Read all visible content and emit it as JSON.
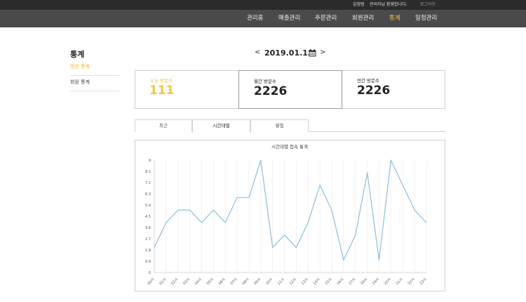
{
  "topbar": {
    "user": "김정범",
    "welcome": "관리자님 환영합니다.",
    "logout": "로그아웃"
  },
  "nav": {
    "items": [
      {
        "label": "관리홈",
        "active": false
      },
      {
        "label": "매출관리",
        "active": false
      },
      {
        "label": "주문관리",
        "active": false
      },
      {
        "label": "회원관리",
        "active": false
      },
      {
        "label": "통계",
        "active": true
      },
      {
        "label": "일정관리",
        "active": false
      }
    ],
    "active_color": "#f6c343"
  },
  "sidebar": {
    "title": "통계",
    "items": [
      {
        "label": "방문 통계",
        "active": true
      },
      {
        "label": "회원 통계",
        "active": false
      }
    ]
  },
  "date_nav": {
    "prev": "<",
    "date": "2019.01.13",
    "next": ">",
    "calendar_icon": "calendar-icon"
  },
  "stats": [
    {
      "label": "오늘 방문수",
      "value": "111",
      "color": "#f6c343"
    },
    {
      "label": "월간 방문수",
      "value": "2226",
      "color": "#222222"
    },
    {
      "label": "연간 방문수",
      "value": "2226",
      "color": "#222222"
    }
  ],
  "tabs": [
    {
      "label": "최근",
      "active": false
    },
    {
      "label": "시간대별",
      "active": true
    },
    {
      "label": "월별",
      "active": false
    }
  ],
  "chart_data": {
    "type": "line",
    "title": "시간대별 접속 통계",
    "categories": [
      "00시",
      "01시",
      "02시",
      "03시",
      "04시",
      "05시",
      "06시",
      "07시",
      "08시",
      "09시",
      "10시",
      "11시",
      "12시",
      "13시",
      "14시",
      "15시",
      "16시",
      "17시",
      "18시",
      "19시",
      "20시",
      "21시",
      "22시",
      "23시"
    ],
    "values": [
      2,
      4,
      5,
      5,
      4,
      5,
      4,
      6,
      6,
      9,
      2,
      3,
      2,
      4,
      7,
      5,
      1,
      3,
      8,
      1,
      9,
      7,
      5,
      4
    ],
    "yticks": [
      "0",
      "0.9",
      "1.8",
      "2.7",
      "3.6",
      "4.5",
      "5.4",
      "6.3",
      "7.2",
      "8.1",
      "9"
    ],
    "ylim": [
      0,
      9
    ],
    "line_color": "#89bfe0",
    "grid": true
  }
}
